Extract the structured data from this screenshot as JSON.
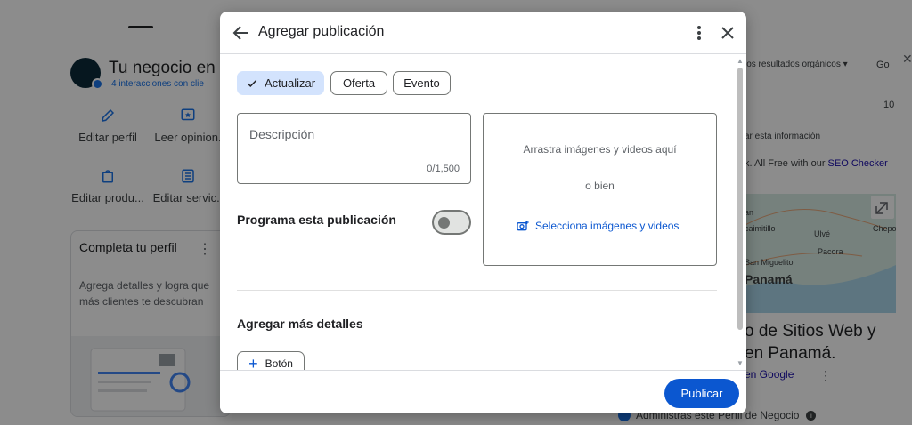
{
  "background": {
    "business_title": "Tu negocio en G",
    "business_sub": "4 interacciones con clie",
    "actions": [
      {
        "label": "Editar perfil",
        "icon": "pencil-icon"
      },
      {
        "label": "Leer opinion.",
        "icon": "review-icon"
      },
      {
        "label": "Editar produ...",
        "icon": "shopping-bag-icon"
      },
      {
        "label": "Editar servic..",
        "icon": "list-icon"
      }
    ],
    "card": {
      "title": "Completa tu perfil",
      "text": "Agrega detalles y logra que más clientes te descubran"
    },
    "right": {
      "filter": "los resultados orgánicos",
      "go": "Go",
      "number": "10",
      "info": "ar esta información",
      "seo_prefix": "k. All Free with our ",
      "seo_link": "SEO Checker",
      "map_labels": [
        "an",
        "caimitillo",
        "Ulvé",
        "Chepo",
        "Pacora",
        "San Miguelito",
        "Panamá"
      ],
      "big_text_1": "o de Sitios Web y",
      "big_text_2": "en Panamá.",
      "google_link": "en Google",
      "footer": "Administras este Perfil de Negocio"
    }
  },
  "dialog": {
    "title": "Agregar publicación",
    "chips": [
      {
        "label": "Actualizar",
        "selected": true
      },
      {
        "label": "Oferta",
        "selected": false
      },
      {
        "label": "Evento",
        "selected": false
      }
    ],
    "description": {
      "placeholder": "Descripción",
      "counter": "0/1,500"
    },
    "schedule": {
      "label": "Programa esta publicación",
      "enabled": false
    },
    "upload": {
      "drag_text": "Arrastra imágenes y videos aquí",
      "or_text": "o bien",
      "link_text": "Selecciona imágenes y videos"
    },
    "more_details_label": "Agregar más detalles",
    "button_label": "Botón",
    "publish_label": "Publicar"
  },
  "colors": {
    "primary": "#0b57d0",
    "chip_selected": "#d3e3fd",
    "overlay": "rgba(0,0,0,0.45)"
  }
}
